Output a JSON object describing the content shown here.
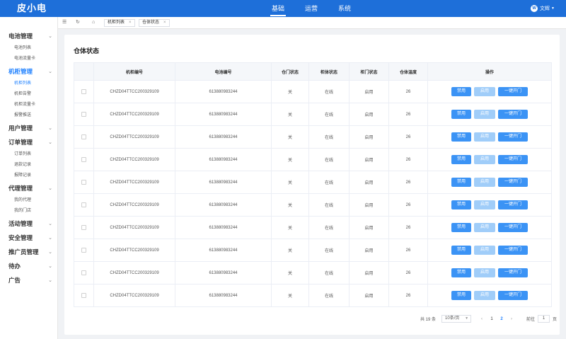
{
  "app": {
    "logo": "皮小电"
  },
  "topnav": [
    {
      "label": "基础",
      "active": true
    },
    {
      "label": "运营",
      "active": false
    },
    {
      "label": "系统",
      "active": false
    }
  ],
  "user": {
    "avatar_letter": "W",
    "name": "文辉"
  },
  "sidebar": [
    {
      "label": "电池管理",
      "active": false,
      "expanded": true,
      "items": [
        {
          "label": "电池列表",
          "active": false
        },
        {
          "label": "电池流量卡",
          "active": false
        }
      ]
    },
    {
      "label": "机柜管理",
      "active": true,
      "expanded": true,
      "items": [
        {
          "label": "机柜列表",
          "active": true
        },
        {
          "label": "机柜告警",
          "active": false
        },
        {
          "label": "机柜流量卡",
          "active": false
        },
        {
          "label": "报警推送",
          "active": false
        }
      ]
    },
    {
      "label": "用户管理",
      "active": false,
      "expanded": false,
      "items": []
    },
    {
      "label": "订单管理",
      "active": false,
      "expanded": true,
      "items": [
        {
          "label": "订单列表",
          "active": false
        },
        {
          "label": "退款记录",
          "active": false
        },
        {
          "label": "报障记录",
          "active": false
        }
      ]
    },
    {
      "label": "代理管理",
      "active": false,
      "expanded": true,
      "items": [
        {
          "label": "我的代理",
          "active": false
        },
        {
          "label": "我的门店",
          "active": false
        }
      ]
    },
    {
      "label": "活动管理",
      "active": false,
      "expanded": false,
      "items": []
    },
    {
      "label": "安全管理",
      "active": false,
      "expanded": false,
      "items": []
    },
    {
      "label": "推广员管理",
      "active": false,
      "expanded": false,
      "items": []
    },
    {
      "label": "待办",
      "active": false,
      "expanded": false,
      "items": []
    },
    {
      "label": "广告",
      "active": false,
      "expanded": false,
      "items": []
    }
  ],
  "tabs": [
    {
      "label": "机柜列表"
    },
    {
      "label": "仓体状态"
    }
  ],
  "page": {
    "title": "仓体状态"
  },
  "table": {
    "headers": [
      "",
      "机柜编号",
      "电池编号",
      "仓门状态",
      "柜体状态",
      "柜门状态",
      "仓体温度",
      "操作"
    ],
    "actions": {
      "disable": "禁用",
      "enable": "启用",
      "open": "一键开门"
    },
    "rows": [
      {
        "cabinet_no": "CHZD04TTCC200329109",
        "battery_no": "613880983244",
        "door": "关",
        "body": "在线",
        "gate": "启用",
        "temp": "26"
      },
      {
        "cabinet_no": "CHZD04TTCC200329109",
        "battery_no": "613880983244",
        "door": "关",
        "body": "在线",
        "gate": "启用",
        "temp": "26"
      },
      {
        "cabinet_no": "CHZD04TTCC200329109",
        "battery_no": "613880983244",
        "door": "关",
        "body": "在线",
        "gate": "启用",
        "temp": "26"
      },
      {
        "cabinet_no": "CHZD04TTCC200329109",
        "battery_no": "613880983244",
        "door": "关",
        "body": "在线",
        "gate": "启用",
        "temp": "26"
      },
      {
        "cabinet_no": "CHZD04TTCC200329109",
        "battery_no": "613880983244",
        "door": "关",
        "body": "在线",
        "gate": "启用",
        "temp": "26"
      },
      {
        "cabinet_no": "CHZD04TTCC200329109",
        "battery_no": "613880983244",
        "door": "关",
        "body": "在线",
        "gate": "启用",
        "temp": "26"
      },
      {
        "cabinet_no": "CHZD04TTCC200329109",
        "battery_no": "613880983244",
        "door": "关",
        "body": "在线",
        "gate": "启用",
        "temp": "26"
      },
      {
        "cabinet_no": "CHZD04TTCC200329109",
        "battery_no": "613880983244",
        "door": "关",
        "body": "在线",
        "gate": "启用",
        "temp": "26"
      },
      {
        "cabinet_no": "CHZD04TTCC200329109",
        "battery_no": "613880983244",
        "door": "关",
        "body": "在线",
        "gate": "启用",
        "temp": "26"
      },
      {
        "cabinet_no": "CHZD04TTCC200329109",
        "battery_no": "613880983244",
        "door": "关",
        "body": "在线",
        "gate": "启用",
        "temp": "26"
      }
    ]
  },
  "pagination": {
    "total": "共 19 条",
    "page_size": "10条/页",
    "prev": "‹",
    "pages": [
      "1",
      "2"
    ],
    "current": "2",
    "next": "›",
    "goto_label": "前往",
    "goto_value": "1",
    "goto_suffix": "页"
  },
  "colors": {
    "primary": "#1e6fd9",
    "button": "#3b93f5",
    "button_disabled": "#a0cdf9"
  }
}
